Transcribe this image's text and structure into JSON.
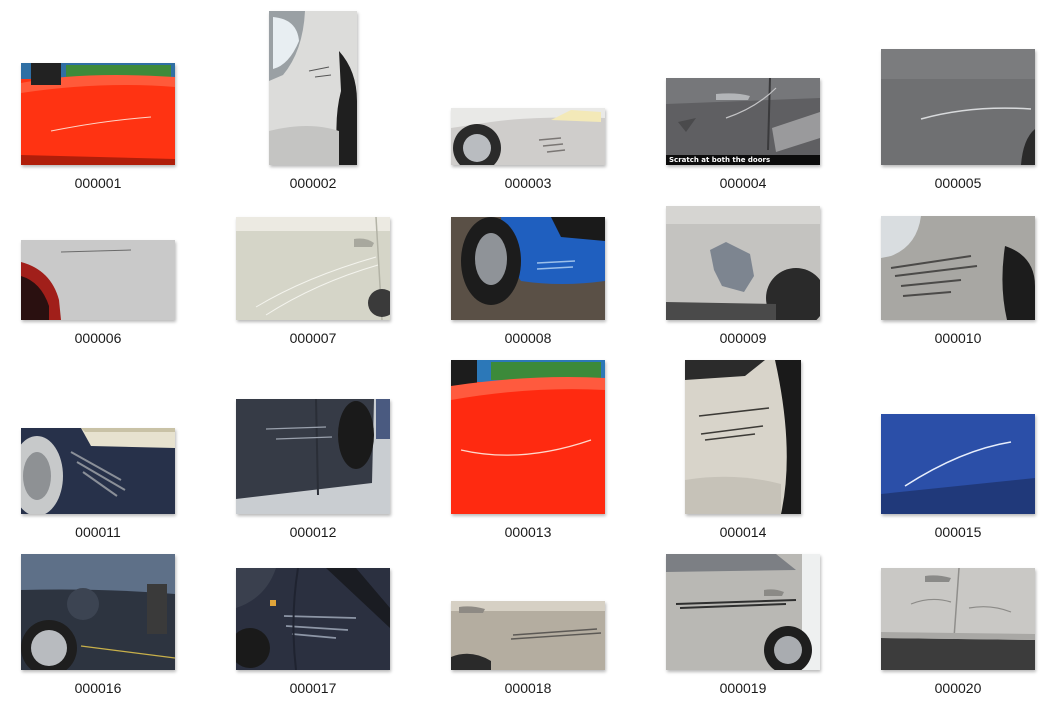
{
  "files": [
    {
      "name": "000001",
      "icon": "red-car-door-scratch-thumbnail"
    },
    {
      "name": "000002",
      "icon": "silver-car-fender-scratch-thumbnail"
    },
    {
      "name": "000003",
      "icon": "silver-car-bumper-scratch-thumbnail"
    },
    {
      "name": "000004",
      "icon": "grey-car-doors-scratch-thumbnail",
      "overlay_text": "Scratch at both the doors"
    },
    {
      "name": "000005",
      "icon": "grey-car-panel-scratch-thumbnail"
    },
    {
      "name": "000006",
      "icon": "silver-car-scratch-thumbnail"
    },
    {
      "name": "000007",
      "icon": "beige-car-door-scratch-thumbnail"
    },
    {
      "name": "000008",
      "icon": "blue-car-bumper-scratch-thumbnail"
    },
    {
      "name": "000009",
      "icon": "silver-car-paint-chip-thumbnail"
    },
    {
      "name": "000010",
      "icon": "silver-car-bumper-scrape-thumbnail"
    },
    {
      "name": "000011",
      "icon": "navy-car-bumper-scrape-thumbnail"
    },
    {
      "name": "000012",
      "icon": "dark-grey-car-door-scratch-thumbnail"
    },
    {
      "name": "000013",
      "icon": "red-car-door-scratch-thumbnail"
    },
    {
      "name": "000014",
      "icon": "white-car-bumper-scratch-thumbnail"
    },
    {
      "name": "000015",
      "icon": "blue-car-paint-scratch-thumbnail"
    },
    {
      "name": "000016",
      "icon": "dark-car-fuel-door-scratch-thumbnail"
    },
    {
      "name": "000017",
      "icon": "navy-car-fender-dent-thumbnail"
    },
    {
      "name": "000018",
      "icon": "silver-car-door-scrape-thumbnail"
    },
    {
      "name": "000019",
      "icon": "silver-car-door-scratch-thumbnail"
    },
    {
      "name": "000020",
      "icon": "silver-car-doors-dent-thumbnail"
    }
  ]
}
